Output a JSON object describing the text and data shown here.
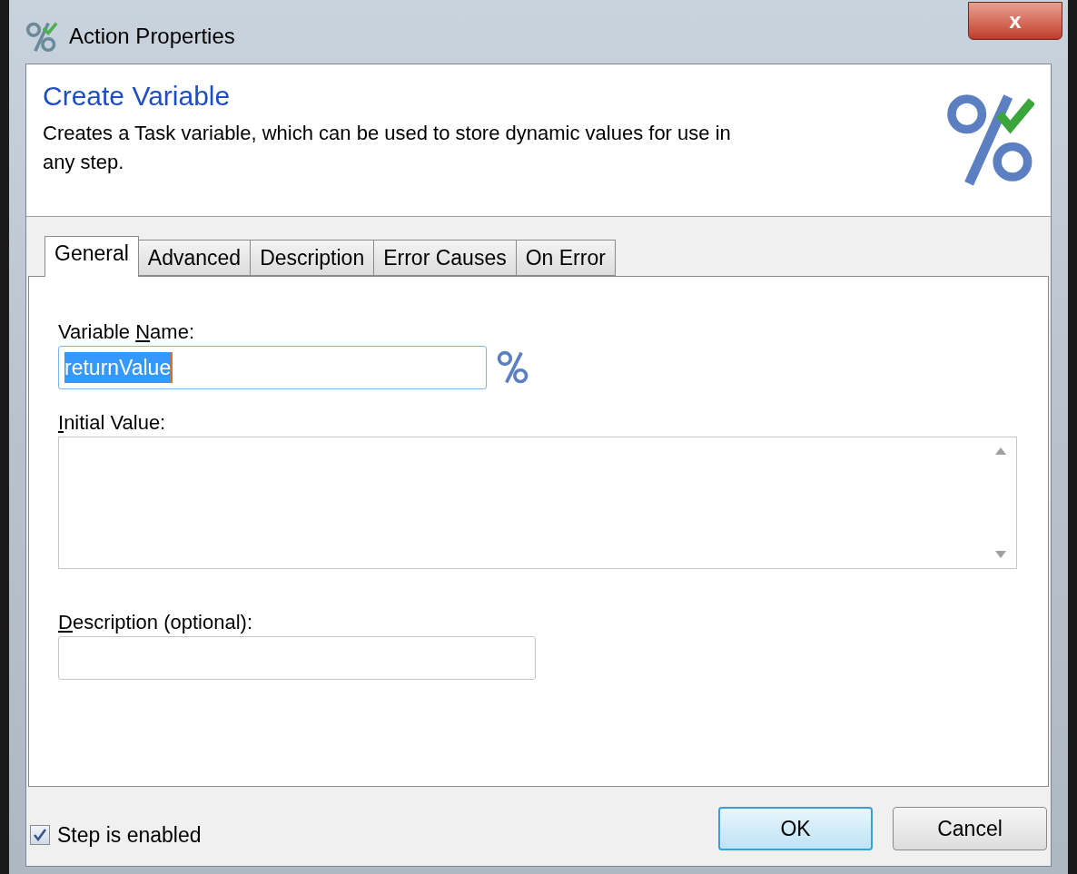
{
  "window": {
    "title": "Action Properties",
    "close": "x"
  },
  "header": {
    "title": "Create Variable",
    "description": "Creates a Task variable, which can be used to store dynamic values for use in any step."
  },
  "tabs": [
    {
      "label": "General",
      "selected": true
    },
    {
      "label": "Advanced",
      "selected": false
    },
    {
      "label": "Description",
      "selected": false
    },
    {
      "label": "Error Causes",
      "selected": false
    },
    {
      "label": "On Error",
      "selected": false
    }
  ],
  "fields": [
    {
      "kind": "text",
      "label": {
        "before": "Variable ",
        "key": "N",
        "after": "ame:"
      },
      "value": "returnValue",
      "selected_text": true,
      "variable_button": true
    },
    {
      "kind": "multiline",
      "label": {
        "key": "I",
        "after": "nitial Value:"
      }
    },
    {
      "kind": "short",
      "label": {
        "key": "D",
        "after": "escription (optional):"
      }
    }
  ],
  "step_enabled": {
    "label": "Step is enabled",
    "checked": true
  },
  "buttons": [
    {
      "label": "OK",
      "default": true
    },
    {
      "label": "Cancel",
      "default": false
    }
  ]
}
